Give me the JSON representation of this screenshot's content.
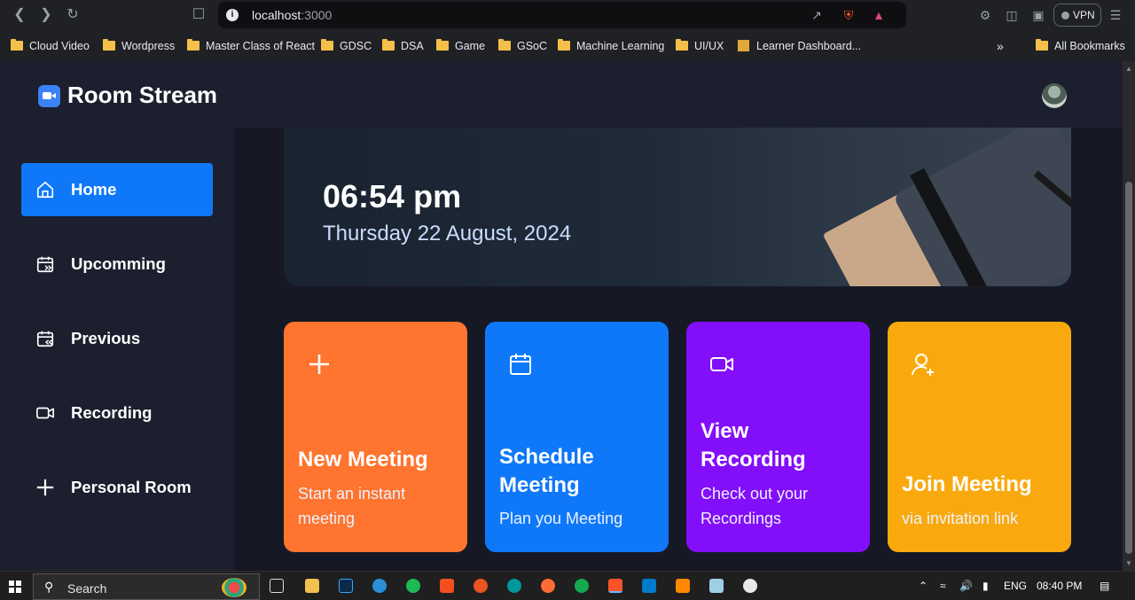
{
  "browser": {
    "url_host": "localhost",
    "url_port": ":3000",
    "vpn_label": "VPN",
    "bookmarks": [
      "Cloud Video",
      "Wordpress",
      "Master Class of React",
      "GDSC",
      "DSA",
      "Game",
      "GSoC",
      "Machine Learning",
      "UI/UX",
      "Learner Dashboard..."
    ],
    "overflow": "»",
    "all_bookmarks": "All Bookmarks"
  },
  "app": {
    "brand": "Room Stream"
  },
  "sidebar": {
    "items": [
      {
        "label": "Home",
        "icon": "home-icon",
        "active": true
      },
      {
        "label": "Upcomming",
        "icon": "calendar-forward-icon"
      },
      {
        "label": "Previous",
        "icon": "calendar-back-icon"
      },
      {
        "label": "Recording",
        "icon": "video-icon"
      },
      {
        "label": "Personal Room",
        "icon": "plus-icon"
      }
    ]
  },
  "hero": {
    "time": "06:54 pm",
    "date": "Thursday 22 August, 2024"
  },
  "cards": [
    {
      "title": "New Meeting",
      "subtitle": "Start an instant meeting",
      "icon": "plus-icon",
      "color": "#ff742e"
    },
    {
      "title": "Schedule Meeting",
      "subtitle": "Plan you Meeting",
      "icon": "calendar-icon",
      "color": "#0e78f9"
    },
    {
      "title": "View Recording",
      "subtitle": "Check out your Recordings",
      "icon": "video-icon",
      "color": "#830ef9"
    },
    {
      "title": "Join Meeting",
      "subtitle": "via invitation link",
      "icon": "user-plus-icon",
      "color": "#f9a90e"
    }
  ],
  "taskbar": {
    "search_placeholder": "Search",
    "language": "ENG",
    "time": "08:40 PM"
  }
}
